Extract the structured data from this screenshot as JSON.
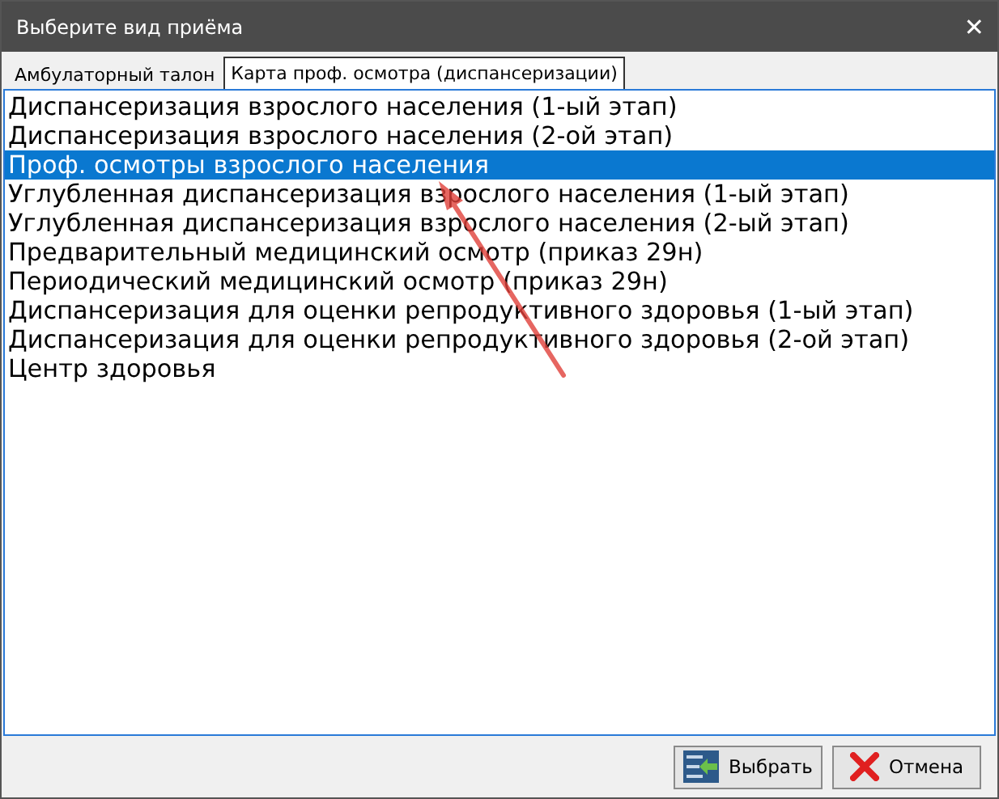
{
  "window": {
    "title": "Выберите вид приёма",
    "close": "✕"
  },
  "tabs": [
    {
      "label": "Амбулаторный талон",
      "selected": false
    },
    {
      "label": "Карта проф. осмотра (диспансеризации)",
      "selected": true
    }
  ],
  "items": [
    {
      "label": "Диспансеризация взрослого населения (1-ый этап)",
      "selected": false
    },
    {
      "label": "Диспансеризация взрослого населения (2-ой этап)",
      "selected": false
    },
    {
      "label": "Проф. осмотры взрослого населения",
      "selected": true
    },
    {
      "label": "Углубленная диспансеризация взрослого населения (1-ый этап)",
      "selected": false
    },
    {
      "label": "Углубленная диспансеризация взрослого населения (2-ый этап)",
      "selected": false
    },
    {
      "label": "Предварительный медицинский осмотр (приказ 29н)",
      "selected": false
    },
    {
      "label": "Периодический медицинский осмотр (приказ 29н)",
      "selected": false
    },
    {
      "label": "Диспансеризация для оценки репродуктивного здоровья (1-ый этап)",
      "selected": false
    },
    {
      "label": "Диспансеризация для оценки репродуктивного здоровья (2-ой этап)",
      "selected": false
    },
    {
      "label": "Центр здоровья",
      "selected": false
    }
  ],
  "buttons": [
    {
      "kind": "choose",
      "label": "Выбрать"
    },
    {
      "kind": "cancel",
      "label": "Отмена"
    }
  ]
}
